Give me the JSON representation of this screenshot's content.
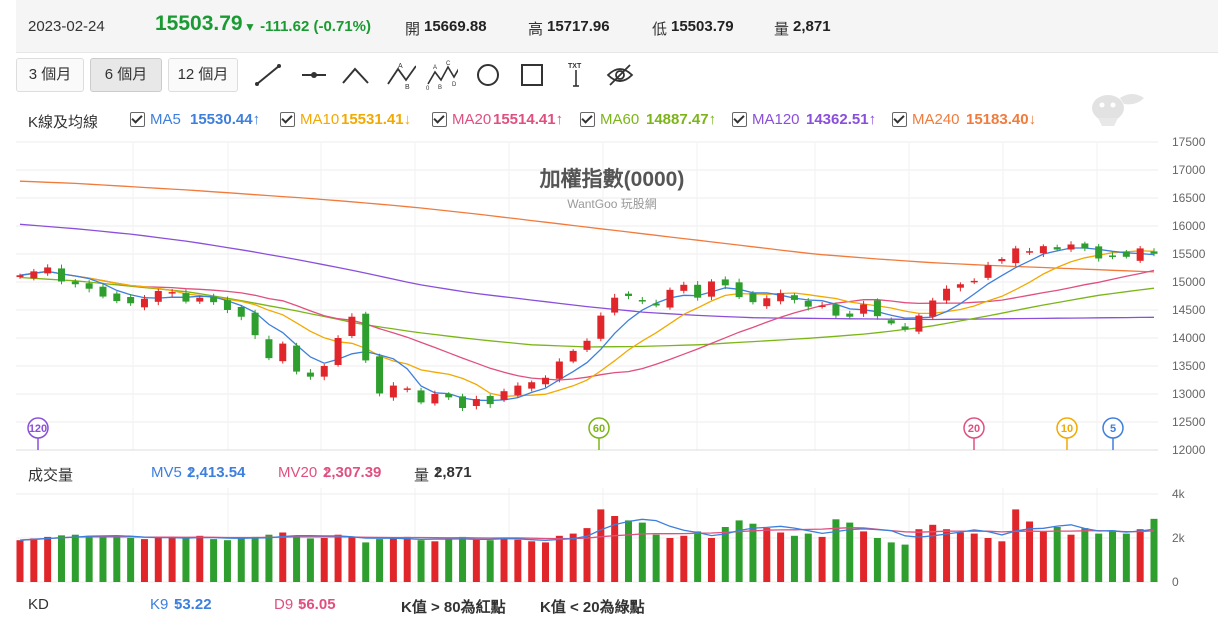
{
  "header": {
    "date": "2023-02-24",
    "price": "15503.79",
    "change": "-111.62 (-0.71%)",
    "open_label": "開",
    "open": "15669.88",
    "high_label": "高",
    "high": "15717.96",
    "low_label": "低",
    "low": "15503.79",
    "vol_label": "量",
    "vol": "2,871"
  },
  "periods": [
    "3 個月",
    "6 個月",
    "12 個月"
  ],
  "active_period": 1,
  "tools": [
    "line-tool-icon",
    "horizontal-line-tool-icon",
    "angle-tool-icon",
    "abc-wave-tool-icon",
    "abcde-wave-tool-icon",
    "circle-tool-icon",
    "rectangle-tool-icon",
    "text-tool-icon",
    "hide-drawings-icon"
  ],
  "ma": {
    "label": "K線及均線",
    "items": [
      {
        "name": "MA5",
        "value": "15530.44",
        "arrow": "↑",
        "color": "#3d7fdc"
      },
      {
        "name": "MA10",
        "value": "15531.41",
        "arrow": "↓",
        "color": "#f2a900"
      },
      {
        "name": "MA20",
        "value": "15514.41",
        "arrow": "↑",
        "color": "#e0507f"
      },
      {
        "name": "MA60",
        "value": "14887.47",
        "arrow": "↑",
        "color": "#7cb518"
      },
      {
        "name": "MA120",
        "value": "14362.51",
        "arrow": "↑",
        "color": "#8a4fdb"
      },
      {
        "name": "MA240",
        "value": "15183.40",
        "arrow": "↓",
        "color": "#f07b3c"
      }
    ]
  },
  "volume_row": {
    "label": "成交量",
    "mv5_name": "MV5",
    "mv5_value": "2,413.54",
    "mv5_arrow": "↑",
    "mv20_name": "MV20",
    "mv20_value": "2,307.39",
    "mv20_arrow": "↑",
    "vol_name": "量",
    "vol_value": "2,871",
    "vol_arrow": "↑"
  },
  "kd_row": {
    "label": "KD",
    "k_name": "K9",
    "k_value": "53.22",
    "k_arrow": "↓",
    "d_name": "D9",
    "d_value": "56.05",
    "d_arrow": "↓",
    "note1": "K值 > 80為紅點",
    "note2": "K值 < 20為綠點"
  },
  "chart_data": {
    "type": "candlestick",
    "title": "加權指數(0000)",
    "subtitle": "WantGoo 玩股網",
    "ylim": [
      12000,
      17500
    ],
    "yticks": [
      12000,
      12500,
      13000,
      13500,
      14000,
      14500,
      15000,
      15500,
      16000,
      16500,
      17000,
      17500
    ],
    "close": [
      15120,
      15190,
      15260,
      15010,
      14960,
      14880,
      14740,
      14660,
      14620,
      14700,
      14840,
      14820,
      14650,
      14720,
      14640,
      14500,
      14380,
      14050,
      13640,
      13900,
      13400,
      13310,
      13500,
      14000,
      14380,
      13600,
      13010,
      13150,
      13100,
      12850,
      13000,
      12940,
      12750,
      12910,
      12820,
      13050,
      13150,
      13210,
      13290,
      13580,
      13770,
      13950,
      14400,
      14720,
      14750,
      14670,
      14580,
      14860,
      14950,
      14720,
      15010,
      14940,
      14730,
      14640,
      14710,
      14800,
      14680,
      14560,
      14580,
      14400,
      14380,
      14600,
      14390,
      14260,
      14150,
      14400,
      14670,
      14880,
      14960,
      15020,
      15300,
      15410,
      15600,
      15550,
      15640,
      15580,
      15670,
      15600,
      15420,
      15470,
      15450,
      15600,
      15504
    ],
    "series": [
      {
        "name": "MA5",
        "color": "#3d7fdc"
      },
      {
        "name": "MA10",
        "color": "#f2a900"
      },
      {
        "name": "MA20",
        "color": "#e0507f"
      },
      {
        "name": "MA60",
        "color": "#7cb518"
      },
      {
        "name": "MA120",
        "color": "#8a4fdb"
      },
      {
        "name": "MA240",
        "color": "#f07b3c"
      }
    ],
    "ma120_path": [
      16030,
      15950,
      15850,
      15720,
      15560,
      15380,
      15180,
      14960,
      14800,
      14680,
      14560,
      14460,
      14400,
      14360,
      14350,
      14340,
      14330,
      14340,
      14350,
      14360,
      14370
    ],
    "ma240_path": [
      16800,
      16760,
      16700,
      16640,
      16570,
      16500,
      16420,
      16330,
      16220,
      16100,
      15980,
      15860,
      15740,
      15620,
      15500,
      15420,
      15350,
      15300,
      15260,
      15220,
      15180
    ],
    "ma60_path": [
      15080,
      15020,
      14920,
      14820,
      14650,
      14460,
      14250,
      14100,
      13980,
      13880,
      13840,
      13850,
      13880,
      13940,
      14000,
      14080,
      14200,
      14380,
      14580,
      14760,
      14890
    ],
    "marker_labels": [
      "120",
      "60",
      "20",
      "10",
      "5"
    ],
    "volume": [
      1900,
      1980,
      2050,
      2120,
      2150,
      2100,
      2050,
      2100,
      2000,
      1950,
      2000,
      2050,
      1980,
      2100,
      1950,
      1900,
      2000,
      2050,
      2150,
      2250,
      2100,
      1980,
      2000,
      2150,
      2050,
      1800,
      1950,
      2000,
      2050,
      1900,
      1850,
      1950,
      2050,
      1950,
      1900,
      2000,
      1920,
      1850,
      1800,
      2100,
      2200,
      2450,
      3300,
      3000,
      2800,
      2700,
      2150,
      2000,
      2100,
      2300,
      2000,
      2500,
      2800,
      2650,
      2450,
      2250,
      2100,
      2200,
      2050,
      2850,
      2700,
      2300,
      2000,
      1800,
      1700,
      2400,
      2600,
      2400,
      2250,
      2200,
      2000,
      1850,
      3300,
      2750,
      2300,
      2500,
      2150,
      2450,
      2200,
      2350,
      2200,
      2400,
      2871
    ],
    "volume_ylim": [
      0,
      4000
    ],
    "volume_ticks": [
      "4k",
      "2k",
      "0"
    ]
  }
}
